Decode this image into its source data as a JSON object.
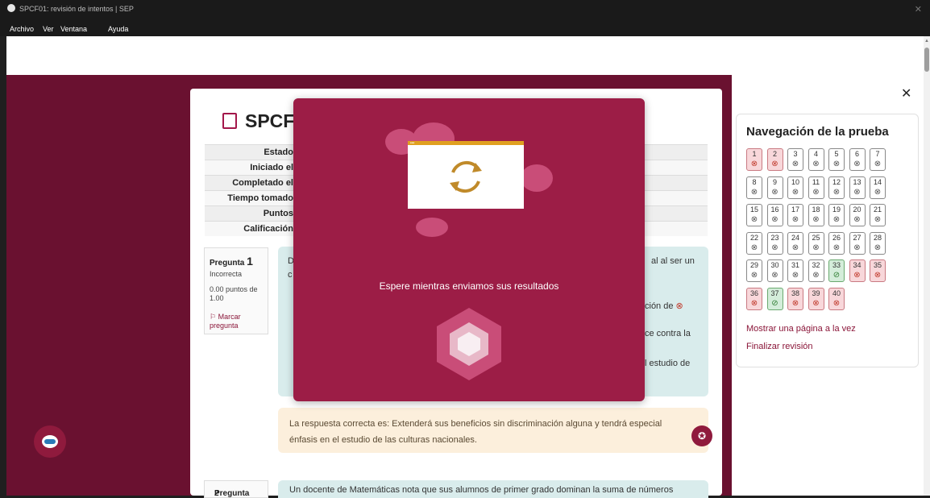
{
  "window": {
    "title": "SPCF01: revisión de intentos | SEP"
  },
  "menu": [
    "Archivo",
    "Ver",
    "Ventana",
    "Ayuda"
  ],
  "page": {
    "title": "SPCF0",
    "summary_labels": [
      "Estado",
      "Iniciado el",
      "Completado el",
      "Tiempo tomado",
      "Puntos",
      "Calificación"
    ]
  },
  "question1": {
    "label": "Pregunta",
    "number": "1",
    "status": "Incorrecta",
    "points": "0.00 puntos de 1.00",
    "flag": "Marcar pregunta",
    "text_fragments": [
      "D",
      "al al ser un",
      "c",
      "ción de",
      "ce contra la",
      "l estudio de"
    ],
    "correct_answer": "La respuesta correcta es: Extenderá sus beneficios sin discriminación alguna y tendrá especial énfasis en el estudio de las culturas nacionales."
  },
  "question2": {
    "label": "Pregunta",
    "number": "2",
    "text": "Un docente de Matemáticas nota que sus alumnos de primer grado dominan la suma de números"
  },
  "modal": {
    "message": "Espere mientras enviamos sus resultados"
  },
  "navigation": {
    "title": "Navegación de la prueba",
    "questions": [
      {
        "n": "1",
        "state": "wrong"
      },
      {
        "n": "2",
        "state": "wrong"
      },
      {
        "n": "3",
        "state": "unanswered"
      },
      {
        "n": "4",
        "state": "unanswered"
      },
      {
        "n": "5",
        "state": "unanswered"
      },
      {
        "n": "6",
        "state": "unanswered"
      },
      {
        "n": "7",
        "state": "unanswered"
      },
      {
        "n": "8",
        "state": "unanswered"
      },
      {
        "n": "9",
        "state": "unanswered"
      },
      {
        "n": "10",
        "state": "unanswered"
      },
      {
        "n": "11",
        "state": "unanswered"
      },
      {
        "n": "12",
        "state": "unanswered"
      },
      {
        "n": "13",
        "state": "unanswered"
      },
      {
        "n": "14",
        "state": "unanswered"
      },
      {
        "n": "15",
        "state": "unanswered"
      },
      {
        "n": "16",
        "state": "unanswered"
      },
      {
        "n": "17",
        "state": "unanswered"
      },
      {
        "n": "18",
        "state": "unanswered"
      },
      {
        "n": "19",
        "state": "unanswered"
      },
      {
        "n": "20",
        "state": "unanswered"
      },
      {
        "n": "21",
        "state": "unanswered"
      },
      {
        "n": "22",
        "state": "unanswered"
      },
      {
        "n": "23",
        "state": "unanswered"
      },
      {
        "n": "24",
        "state": "unanswered"
      },
      {
        "n": "25",
        "state": "unanswered"
      },
      {
        "n": "26",
        "state": "unanswered"
      },
      {
        "n": "27",
        "state": "unanswered"
      },
      {
        "n": "28",
        "state": "unanswered"
      },
      {
        "n": "29",
        "state": "unanswered"
      },
      {
        "n": "30",
        "state": "unanswered"
      },
      {
        "n": "31",
        "state": "unanswered"
      },
      {
        "n": "32",
        "state": "unanswered"
      },
      {
        "n": "33",
        "state": "correct"
      },
      {
        "n": "34",
        "state": "wrong"
      },
      {
        "n": "35",
        "state": "wrong"
      },
      {
        "n": "36",
        "state": "wrong"
      },
      {
        "n": "37",
        "state": "correct"
      },
      {
        "n": "38",
        "state": "wrong"
      },
      {
        "n": "39",
        "state": "wrong"
      },
      {
        "n": "40",
        "state": "wrong"
      }
    ],
    "link_one_page": "Mostrar una página a la vez",
    "link_finish": "Finalizar revisión"
  },
  "colors": {
    "brand": "#6a1130",
    "modal": "#9c1d46",
    "wrong": "#f8d7da",
    "correct": "#d4edda"
  }
}
